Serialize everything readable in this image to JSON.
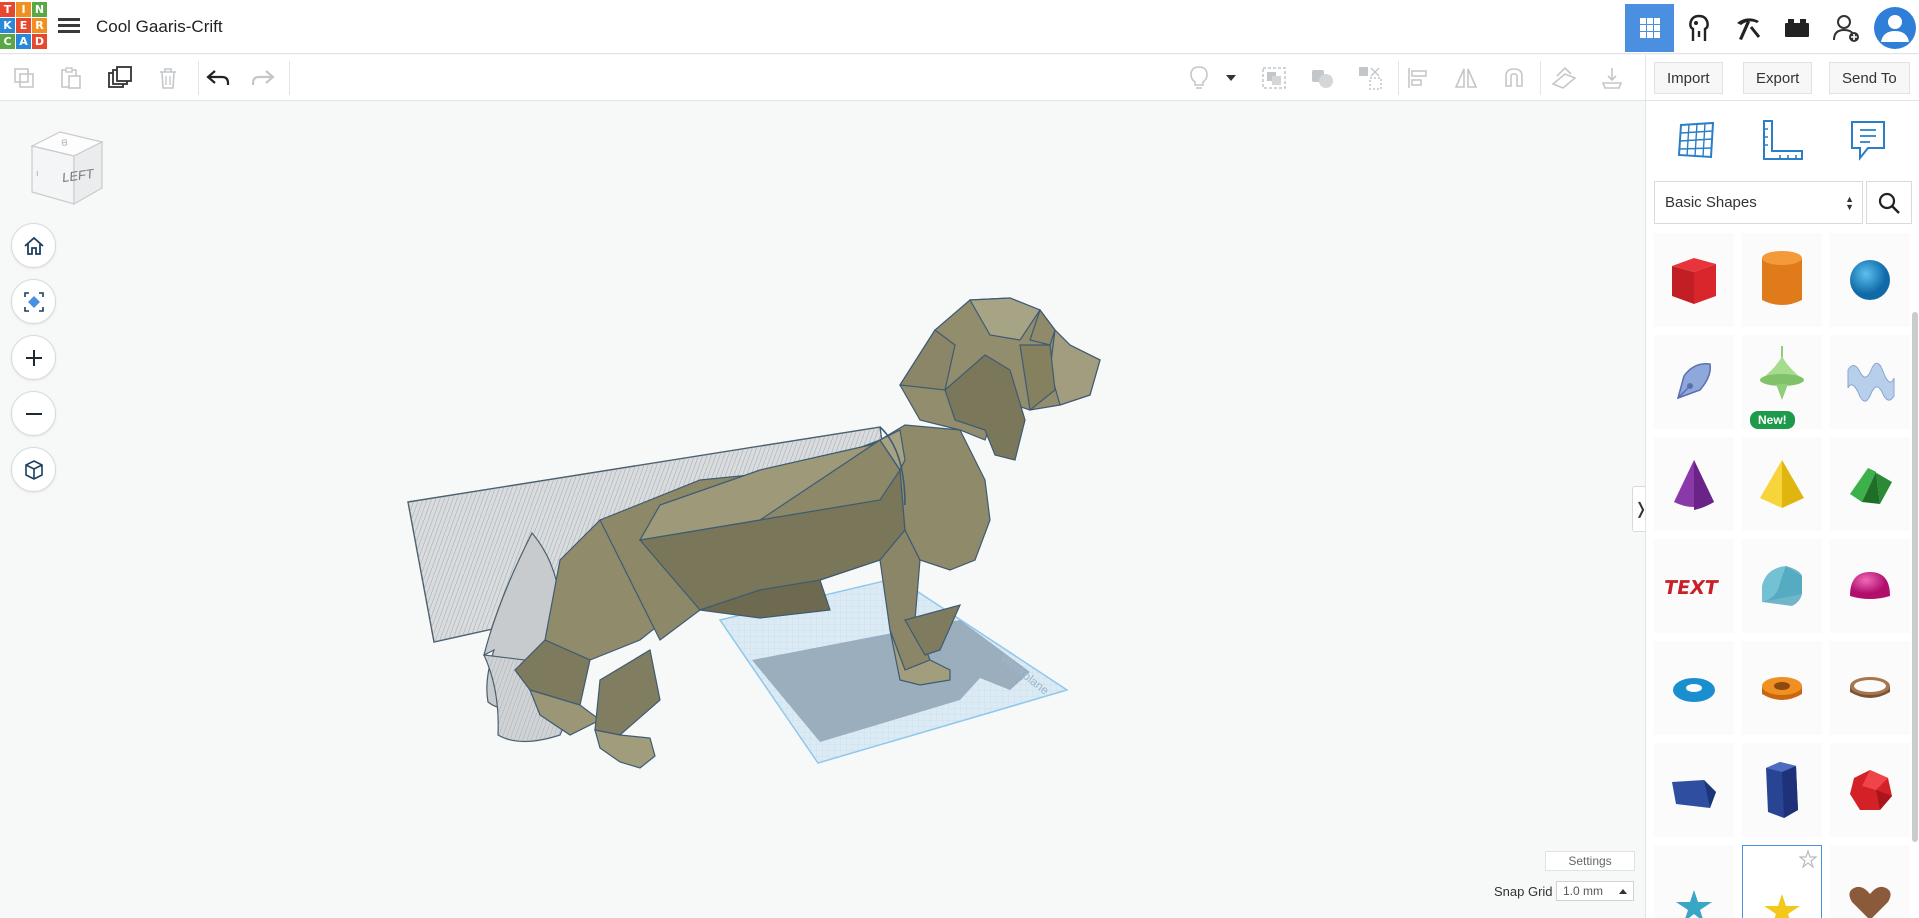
{
  "app": {
    "logo_letters": [
      "T",
      "I",
      "N",
      "K",
      "E",
      "R",
      "C",
      "A",
      "D"
    ],
    "logo_colors": [
      "#e8472f",
      "#f09023",
      "#5aa845",
      "#2a88d8",
      "#e8472f",
      "#f09023",
      "#5aa845",
      "#2a88d8",
      "#e8472f"
    ],
    "design_title": "Cool Gaaris-Crift"
  },
  "nav": {
    "items": [
      {
        "name": "3d-design-icon",
        "active": true
      },
      {
        "name": "circuits-icon",
        "active": false
      },
      {
        "name": "codeblocks-pickaxe-icon",
        "active": false
      },
      {
        "name": "bricks-icon",
        "active": false
      },
      {
        "name": "invite-user-icon",
        "active": false
      },
      {
        "name": "profile-avatar-icon",
        "active": false
      }
    ]
  },
  "toolbar": {
    "import_label": "Import",
    "export_label": "Export",
    "send_to_label": "Send To"
  },
  "viewcube": {
    "face_label": "LEFT"
  },
  "workplane": {
    "watermark": "Workplane"
  },
  "panel": {
    "category": "Basic Shapes",
    "new_badge": "New!",
    "shapes": [
      {
        "name": "box",
        "color": "#d42027"
      },
      {
        "name": "cylinder",
        "color": "#e07b1b"
      },
      {
        "name": "sphere",
        "color": "#1e8fd0"
      },
      {
        "name": "scribble",
        "color": "#7e9ed6"
      },
      {
        "name": "shape-generator",
        "color": "#8fcf7a",
        "new": true
      },
      {
        "name": "wave",
        "color": "#a7c3e6"
      },
      {
        "name": "cone",
        "color": "#7d2c9a"
      },
      {
        "name": "pyramid",
        "color": "#f2c81b"
      },
      {
        "name": "roof",
        "color": "#2f9a3a"
      },
      {
        "name": "text",
        "color": "#c82027"
      },
      {
        "name": "half-cylinder",
        "color": "#61b6c9"
      },
      {
        "name": "half-sphere",
        "color": "#d81b8a"
      },
      {
        "name": "torus",
        "color": "#1a8fd0"
      },
      {
        "name": "tube",
        "color": "#e07b1b"
      },
      {
        "name": "ring",
        "color": "#9b6a46"
      },
      {
        "name": "wedge",
        "color": "#243f8c"
      },
      {
        "name": "hexagonal-prism",
        "color": "#243f8c"
      },
      {
        "name": "polyhedron",
        "color": "#d42027"
      },
      {
        "name": "star",
        "color": "#3aa6c6"
      },
      {
        "name": "star-selected",
        "color": "#f2c81b"
      },
      {
        "name": "heart",
        "color": "#8b5a3a"
      }
    ]
  },
  "bottom": {
    "settings_label": "Settings",
    "snap_grid_label": "Snap Grid",
    "snap_grid_value": "1.0 mm"
  }
}
